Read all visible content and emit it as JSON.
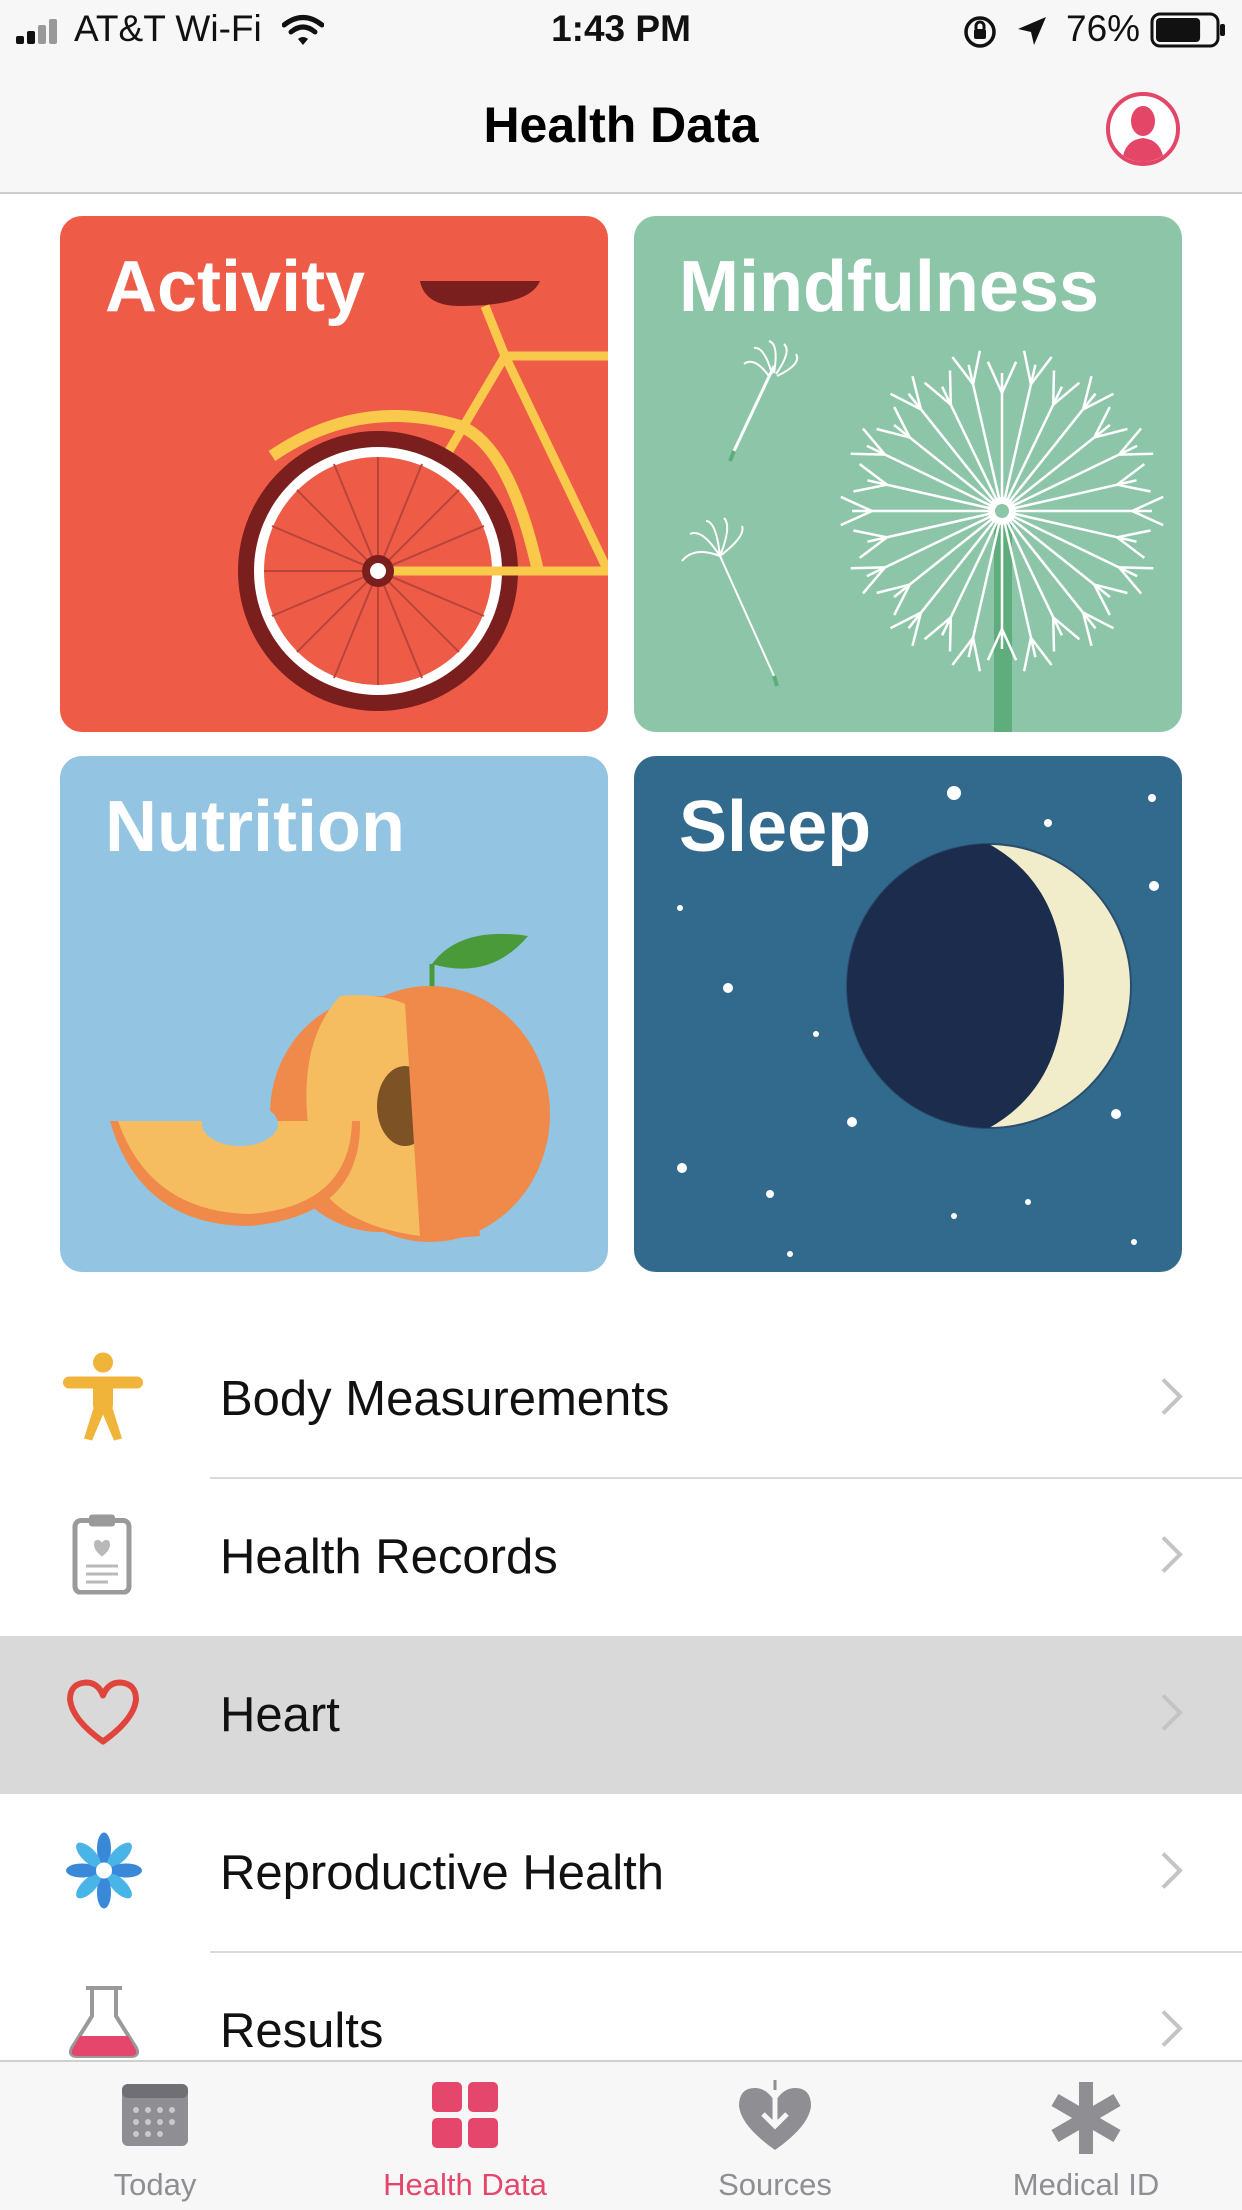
{
  "status_bar": {
    "carrier": "AT&T Wi-Fi",
    "time": "1:43 PM",
    "battery": "76%",
    "battery_level": 0.76,
    "icons": [
      "signal-icon",
      "wifi-icon",
      "orientation-lock-icon",
      "location-icon",
      "battery-icon"
    ]
  },
  "nav": {
    "title": "Health Data",
    "profile_icon": "profile-icon"
  },
  "tiles": [
    {
      "label": "Activity",
      "color": "#ee5c48",
      "art": "bicycle"
    },
    {
      "label": "Mindfulness",
      "color": "#8dc5a8",
      "art": "dandelion"
    },
    {
      "label": "Nutrition",
      "color": "#93c4e2",
      "art": "peach"
    },
    {
      "label": "Sleep",
      "color": "#326a8e",
      "art": "moon"
    }
  ],
  "categories": [
    {
      "label": "Body Measurements",
      "icon": "body-figure-icon"
    },
    {
      "label": "Health Records",
      "icon": "clipboard-icon"
    },
    {
      "label": "Heart",
      "icon": "heart-icon",
      "selected": true
    },
    {
      "label": "Reproductive Health",
      "icon": "flower-icon"
    },
    {
      "label": "Results",
      "icon": "flask-icon"
    }
  ],
  "tab_bar": {
    "tabs": [
      {
        "label": "Today",
        "icon": "calendar-icon",
        "active": false
      },
      {
        "label": "Health Data",
        "icon": "grid-icon",
        "active": true
      },
      {
        "label": "Sources",
        "icon": "sources-heart-icon",
        "active": false
      },
      {
        "label": "Medical ID",
        "icon": "asterisk-icon",
        "active": false
      }
    ],
    "active_color": "#e5466b",
    "inactive_color": "#8e8e93"
  }
}
